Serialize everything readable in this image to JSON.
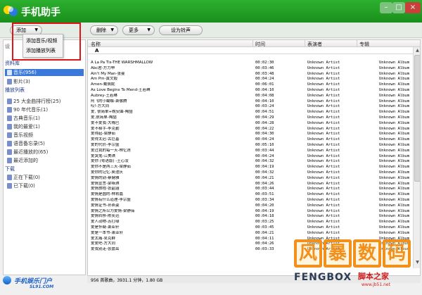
{
  "app": {
    "title": "手机助手"
  },
  "window": {
    "minimize": "–",
    "maximize": "□",
    "close": "×"
  },
  "toolbar": {
    "add_label": "添加",
    "delete_label": "删除",
    "more_label": "更多",
    "ringtone_label": "设为铃声",
    "dropdown_arrow": "▼"
  },
  "add_menu": {
    "items": [
      "添加音乐/视频",
      "添加播放列表"
    ]
  },
  "sidebar": {
    "cut_label": "设",
    "library_header": "资料库",
    "library_items": [
      {
        "label": "音乐(956)",
        "selected": true
      },
      {
        "label": "影片(3)",
        "selected": false
      }
    ],
    "playlist_header": "播放列表",
    "playlist_items": [
      "25 大金曲排行榜(25)",
      "90 年代音乐(1)",
      "古典音乐(1)",
      "我的最爱(1)",
      "音乐视频",
      "语音备忘录(5)",
      "最近播放的(65)",
      "最近添加的"
    ],
    "download_header": "下载",
    "download_items": [
      "正在下载(0)",
      "已下载(0)"
    ],
    "bottom_logo": {
      "text": "手机娱乐门户",
      "sub": "SL91.COM"
    }
  },
  "table": {
    "columns": [
      "名称",
      "时间",
      "表演者",
      "专辑"
    ],
    "filter_value": "A",
    "rows": [
      {
        "name": "A La Pa Tis-THE WARSHMALLOW",
        "time": "00:02:30",
        "artist": "Unknown Artist",
        "album": "Unknown Album"
      },
      {
        "name": "Abc君-方力申",
        "time": "00:03:46",
        "artist": "Unknown Artist",
        "album": "Unknown Album"
      },
      {
        "name": "Ain't My Man-张曼",
        "time": "00:03:48",
        "artist": "Unknown Artist",
        "album": "Unknown Album"
      },
      {
        "name": "Am Pm-黄文毅",
        "time": "00:04:24",
        "artist": "Unknown Artist",
        "album": "Unknown Album"
      },
      {
        "name": "Amen-戴佩妮",
        "time": "00:06:01",
        "artist": "Unknown Artist",
        "album": "Unknown Album"
      },
      {
        "name": "As Love Begins To Mend-王若琳",
        "time": "00:04:10",
        "artist": "Unknown Artist",
        "album": "Unknown Album"
      },
      {
        "name": "Aubrey-王若琳",
        "time": "00:04:08",
        "artist": "Unknown Artist",
        "album": "Unknown Album"
      },
      {
        "name": "阿飞的小蝴蝶-萧敬腾",
        "time": "00:04:10",
        "artist": "Unknown Artist",
        "album": "Unknown Album"
      },
      {
        "name": "哎!-方大同",
        "time": "00:03:24",
        "artist": "Unknown Artist",
        "album": "Unknown Album"
      },
      {
        "name": "爱, 很简单+晚安曲-陶喆",
        "time": "00:04:51",
        "artist": "Unknown Artist",
        "album": "Unknown Album"
      },
      {
        "name": "爱,很简单-陶喆",
        "time": "00:04:29",
        "artist": "Unknown Artist",
        "album": "Unknown Album"
      },
      {
        "name": "爱不爱我-大嘴巴",
        "time": "00:04:28",
        "artist": "Unknown Artist",
        "album": "Unknown Album"
      },
      {
        "name": "爱不释手-李克勤",
        "time": "00:04:22",
        "artist": "Unknown Artist",
        "album": "Unknown Album"
      },
      {
        "name": "爱得起-梁静茹",
        "time": "00:04:30",
        "artist": "Unknown Artist",
        "album": "Unknown Album"
      },
      {
        "name": "爱得太迟-古巨基",
        "time": "00:04:24",
        "artist": "Unknown Artist",
        "album": "Unknown Album"
      },
      {
        "name": "爱的代价-李宗盛",
        "time": "00:05:10",
        "artist": "Unknown Artist",
        "album": "Unknown Album"
      },
      {
        "name": "爱过我的每一天-林忆莲",
        "time": "00:03:44",
        "artist": "Unknown Artist",
        "album": "Unknown Album"
      },
      {
        "name": "爱哭鬼-江美琪",
        "time": "00:04:24",
        "artist": "Unknown Artist",
        "album": "Unknown Album"
      },
      {
        "name": "爱你 (粤语版) -王心凌",
        "time": "00:04:32",
        "artist": "Unknown Artist",
        "album": "Unknown Album"
      },
      {
        "name": "爱你不是两三天-梁静茹",
        "time": "00:04:19",
        "artist": "Unknown Artist",
        "album": "Unknown Album"
      },
      {
        "name": "爱你的记忆-庾澄庆",
        "time": "00:04:32",
        "artist": "Unknown Artist",
        "album": "Unknown Album"
      },
      {
        "name": "爱情的刽-蔡健雅",
        "time": "00:04:21",
        "artist": "Unknown Artist",
        "album": "Unknown Album"
      },
      {
        "name": "爱情宣言-梁咏琪",
        "time": "00:04:26",
        "artist": "Unknown Artist",
        "album": "Unknown Album"
      },
      {
        "name": "爱情旅程-张韶涵",
        "time": "00:03:44",
        "artist": "Unknown Artist",
        "album": "Unknown Album"
      },
      {
        "name": "爱情是圆的-林宥嘉",
        "time": "00:03:51",
        "artist": "Unknown Artist",
        "album": "Unknown Album"
      },
      {
        "name": "爱情有什么道理-李宗盛",
        "time": "00:03:34",
        "artist": "Unknown Artist",
        "album": "Unknown Album"
      },
      {
        "name": "爱情证书-孙燕姿",
        "time": "00:04:20",
        "artist": "Unknown Artist",
        "album": "Unknown Album"
      },
      {
        "name": "爱情之所以为爱情-梁静茹",
        "time": "00:04:19",
        "artist": "Unknown Artist",
        "album": "Unknown Album"
      },
      {
        "name": "爱情转移-陈奕迅",
        "time": "00:04:18",
        "artist": "Unknown Artist",
        "album": "Unknown Album"
      },
      {
        "name": "爱人动物-苏打绿",
        "time": "00:03:25",
        "artist": "Unknown Artist",
        "album": "Unknown Album"
      },
      {
        "name": "爱是怀疑-萧亚轩",
        "time": "00:03:45",
        "artist": "Unknown Artist",
        "album": "Unknown Album"
      },
      {
        "name": "爱是一本书-萧亚轩",
        "time": "00:04:21",
        "artist": "Unknown Artist",
        "album": "Unknown Album"
      },
      {
        "name": "爱太痛-吴克群",
        "time": "00:04:11",
        "artist": "Unknown Artist",
        "album": "Unknown Album"
      },
      {
        "name": "爱爱吧-方大同",
        "time": "00:04:26",
        "artist": "Unknown Artist",
        "album": "Unknown Album"
      },
      {
        "name": "爱我别走-张震岳",
        "time": "00:03:33",
        "artist": "Unknown Artist",
        "album": "Unknown Album"
      }
    ]
  },
  "status": {
    "text": "956 首歌曲，3931.1 分钟，1.80 GB"
  },
  "scrollbar": {
    "up": "▲",
    "down": "▼"
  },
  "watermarks": {
    "big_chars": [
      "风",
      "暴",
      "数",
      "码"
    ],
    "fengbox": "FENGBOX",
    "jb_text": "脚本之家",
    "jb_url": "www.jb51.net"
  },
  "colors": {
    "accent_green": "#1f9b22",
    "selection_blue": "#3a79d9",
    "highlight_red": "#e01515"
  }
}
